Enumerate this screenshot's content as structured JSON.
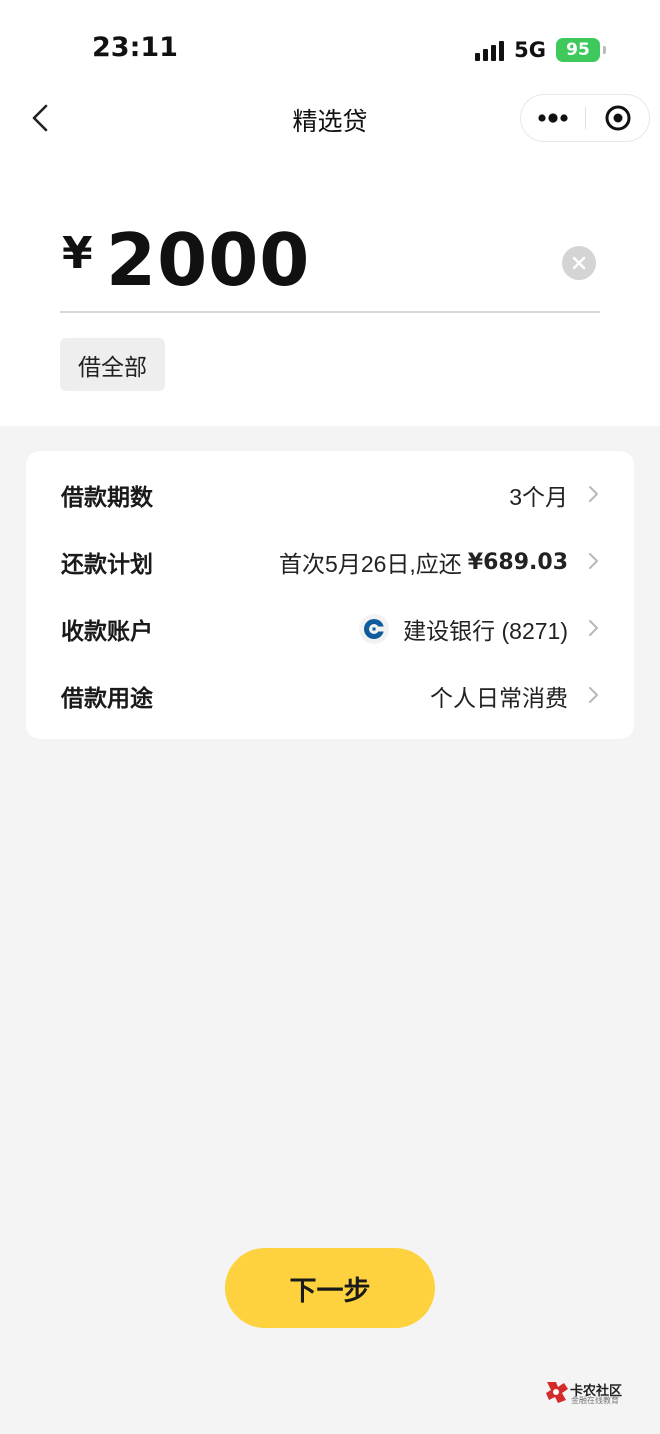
{
  "status_bar": {
    "time": "23:11",
    "network": "5G",
    "battery": "95"
  },
  "nav": {
    "title": "精选贷",
    "back_icon": "chevron-left-icon",
    "more_icon": "ellipsis-icon",
    "target_icon": "target-icon"
  },
  "amount": {
    "currency": "¥",
    "value": "2000",
    "borrow_all_label": "借全部"
  },
  "loan_details": {
    "rows": [
      {
        "label": "借款期数",
        "value": "3个月"
      },
      {
        "label": "还款计划",
        "value": "首次5月26日,应还",
        "amount": "¥689.03"
      },
      {
        "label": "收款账户",
        "value": "建设银行 (8271)",
        "icon": "ccb-bank-icon"
      },
      {
        "label": "借款用途",
        "value": "个人日常消费"
      }
    ]
  },
  "next_button": {
    "label": "下一步"
  },
  "watermark": {
    "title": "卡农社区",
    "subtitle": "金融在线教育"
  },
  "colors": {
    "accent": "#fdd23e",
    "battery": "#3fc85c",
    "bank": "#0f5b9e",
    "watermark": "#d42a2a"
  }
}
